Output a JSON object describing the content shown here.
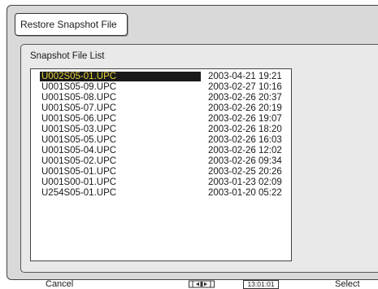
{
  "dialog": {
    "title": "Restore Snapshot File",
    "list_label": "Snapshot File List"
  },
  "files": [
    {
      "name": "U002S05-01.UPC",
      "date": "2003-04-21 19:21",
      "selected": true
    },
    {
      "name": "U001S05-09.UPC",
      "date": "2003-02-27 10:16",
      "selected": false
    },
    {
      "name": "U001S05-08.UPC",
      "date": "2003-02-26 20:37",
      "selected": false
    },
    {
      "name": "U001S05-07.UPC",
      "date": "2003-02-26 20:19",
      "selected": false
    },
    {
      "name": "U001S05-06.UPC",
      "date": "2003-02-26 19:07",
      "selected": false
    },
    {
      "name": "U001S05-03.UPC",
      "date": "2003-02-26 18:20",
      "selected": false
    },
    {
      "name": "U001S05-05.UPC",
      "date": "2003-02-26 16:03",
      "selected": false
    },
    {
      "name": "U001S05-04.UPC",
      "date": "2003-02-26 12:02",
      "selected": false
    },
    {
      "name": "U001S05-02.UPC",
      "date": "2003-02-26 09:34",
      "selected": false
    },
    {
      "name": "U001S05-01.UPC",
      "date": "2003-02-25 20:26",
      "selected": false
    },
    {
      "name": "U001S00-01.UPC",
      "date": "2003-01-23 02:09",
      "selected": false
    },
    {
      "name": "U254S05-01.UPC",
      "date": "2003-01-20 05:22",
      "selected": false
    }
  ],
  "bottom_bar": {
    "cancel_label": "Cancel",
    "time": "13:01:01",
    "select_label": "Select",
    "jog_icon": "jog-dial-icon"
  },
  "colors": {
    "selection_bg": "#1a1a1a",
    "selection_text": "#e6d23a",
    "screen_bg": "#d9d9d9"
  }
}
